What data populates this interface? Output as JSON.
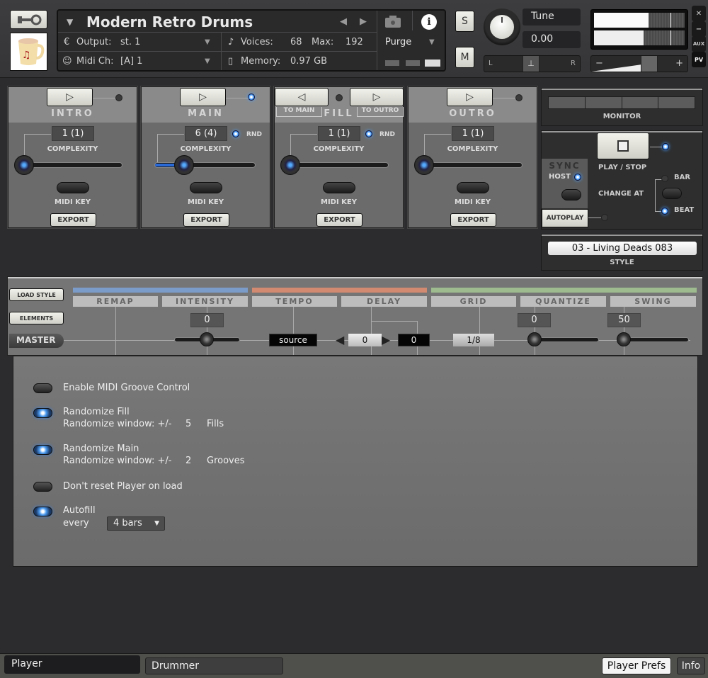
{
  "header": {
    "instrument_title": "Modern Retro Drums",
    "output_label": "Output:",
    "output_value": "st. 1",
    "midi_label": "Midi Ch:",
    "midi_value": "[A]  1",
    "voices_label": "Voices:",
    "voices_value": "68",
    "max_label": "Max:",
    "max_value": "192",
    "memory_label": "Memory:",
    "memory_value": "0.97 GB",
    "purge_label": "Purge",
    "solo_label": "S",
    "mute_label": "M",
    "tune_label": "Tune",
    "tune_value": "0.00",
    "pan_left": "L",
    "pan_right": "R",
    "vol_minus": "−",
    "vol_plus": "+",
    "close_label": "✕",
    "minimize_label": "−",
    "aux_label": "AUX",
    "pv_label": "PV",
    "meter_levels": [
      0.6,
      0.55
    ]
  },
  "sections": [
    {
      "name": "INTRO",
      "complexity": "1 (1)",
      "complexity_label": "COMPLEXITY",
      "midi_key_label": "MIDI KEY",
      "export_label": "EXPORT",
      "active": false,
      "rnd": false,
      "slider_fraction": 0.0
    },
    {
      "name": "MAIN",
      "complexity": "6 (4)",
      "complexity_label": "COMPLEXITY",
      "midi_key_label": "MIDI KEY",
      "export_label": "EXPORT",
      "active": true,
      "rnd": true,
      "rnd_label": "RND",
      "slider_fraction": 0.25
    },
    {
      "name": "FILL",
      "complexity": "1 (1)",
      "complexity_label": "COMPLEXITY",
      "midi_key_label": "MIDI KEY",
      "export_label": "EXPORT",
      "active": false,
      "rnd": true,
      "rnd_label": "RND",
      "to_main_label": "TO MAIN",
      "to_outro_label": "TO OUTRO",
      "slider_fraction": 0.0
    },
    {
      "name": "OUTRO",
      "complexity": "1 (1)",
      "complexity_label": "COMPLEXITY",
      "midi_key_label": "MIDI KEY",
      "export_label": "EXPORT",
      "active": false,
      "rnd": false,
      "slider_fraction": 0.0
    }
  ],
  "right_panel": {
    "monitor_label": "MONITOR",
    "play_stop_label": "PLAY / STOP",
    "sync_label": "SYNC",
    "host_label": "HOST",
    "change_at_label": "CHANGE AT",
    "bar_label": "BAR",
    "beat_label": "BEAT",
    "autoplay_label": "AUTOPLAY",
    "style_value": "03 - Living Deads 083",
    "style_label": "STYLE"
  },
  "groove": {
    "load_style_label": "LOAD STYLE",
    "elements_label": "ELEMENTS",
    "master_label": "MASTER",
    "columns": [
      "REMAP",
      "INTENSITY",
      "TEMPO",
      "DELAY",
      "GRID",
      "QUANTIZE",
      "SWING"
    ],
    "colors": {
      "blue": "#7b9cc8",
      "orange": "#d28a70",
      "green": "#9dbb8e"
    },
    "intensity_value": "0",
    "tempo_value": "source",
    "delay_value": "0",
    "delay_value2": "0",
    "grid_value": "1/8",
    "quantize_value": "0",
    "swing_value": "50"
  },
  "prefs": {
    "enable_midi_groove": {
      "label": "Enable MIDI Groove Control",
      "on": false
    },
    "randomize_fill": {
      "label": "Randomize Fill",
      "window_label": "Randomize window: +/-",
      "window_value": "5",
      "unit": "Fills",
      "on": true
    },
    "randomize_main": {
      "label": "Randomize Main",
      "window_label": "Randomize window: +/-",
      "window_value": "2",
      "unit": "Grooves",
      "on": true
    },
    "dont_reset": {
      "label": "Don't reset Player on load",
      "on": false
    },
    "autofill": {
      "label": "Autofill",
      "every_label": "every",
      "every_value": "4 bars",
      "on": true
    }
  },
  "bottom_tabs": {
    "player": "Player",
    "drummer": "Drummer",
    "player_prefs": "Player Prefs",
    "info": "Info"
  }
}
